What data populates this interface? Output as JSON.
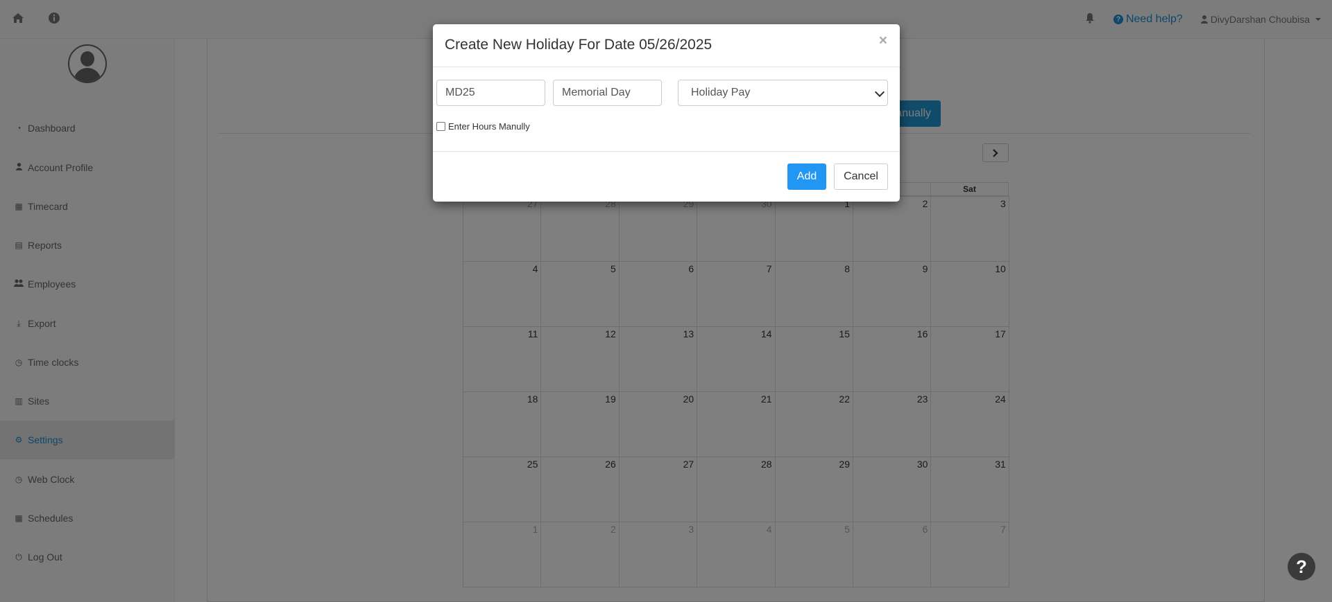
{
  "navbar": {
    "home_icon": "home-icon",
    "info_icon": "info-icon",
    "bell_icon": "bell-icon",
    "help_label": "Need help?",
    "user_name": "DivyDarshan Choubisa"
  },
  "sidebar": {
    "items": [
      {
        "label": "Dashboard",
        "icon": "dashboard-icon"
      },
      {
        "label": "Account Profile",
        "icon": "user-icon"
      },
      {
        "label": "Timecard",
        "icon": "table-icon"
      },
      {
        "label": "Reports",
        "icon": "list-icon"
      },
      {
        "label": "Employees",
        "icon": "users-icon"
      },
      {
        "label": "Export",
        "icon": "download-icon"
      },
      {
        "label": "Time clocks",
        "icon": "clock-icon"
      },
      {
        "label": "Sites",
        "icon": "building-icon"
      },
      {
        "label": "Settings",
        "icon": "gear-icon",
        "active": true
      },
      {
        "label": "Web Clock",
        "icon": "clock-icon"
      },
      {
        "label": "Schedules",
        "icon": "calendar-icon"
      },
      {
        "label": "Log Out",
        "icon": "power-icon"
      }
    ]
  },
  "main": {
    "manual_button_label": "anually",
    "next_label": ">"
  },
  "calendar": {
    "visible_headers": [
      "Sat"
    ],
    "weeks": [
      [
        {
          "d": "27",
          "o": true
        },
        {
          "d": "28",
          "o": true
        },
        {
          "d": "29",
          "o": true
        },
        {
          "d": "30",
          "o": true
        },
        {
          "d": "1"
        },
        {
          "d": "2"
        },
        {
          "d": "3"
        }
      ],
      [
        {
          "d": "4"
        },
        {
          "d": "5"
        },
        {
          "d": "6"
        },
        {
          "d": "7"
        },
        {
          "d": "8"
        },
        {
          "d": "9"
        },
        {
          "d": "10"
        }
      ],
      [
        {
          "d": "11"
        },
        {
          "d": "12"
        },
        {
          "d": "13"
        },
        {
          "d": "14"
        },
        {
          "d": "15"
        },
        {
          "d": "16"
        },
        {
          "d": "17"
        }
      ],
      [
        {
          "d": "18"
        },
        {
          "d": "19"
        },
        {
          "d": "20"
        },
        {
          "d": "21"
        },
        {
          "d": "22"
        },
        {
          "d": "23"
        },
        {
          "d": "24"
        }
      ],
      [
        {
          "d": "25"
        },
        {
          "d": "26"
        },
        {
          "d": "27"
        },
        {
          "d": "28"
        },
        {
          "d": "29"
        },
        {
          "d": "30"
        },
        {
          "d": "31"
        }
      ],
      [
        {
          "d": "1",
          "o": true
        },
        {
          "d": "2",
          "o": true
        },
        {
          "d": "3",
          "o": true
        },
        {
          "d": "4",
          "o": true
        },
        {
          "d": "5",
          "o": true
        },
        {
          "d": "6",
          "o": true
        },
        {
          "d": "7",
          "o": true
        }
      ]
    ]
  },
  "modal": {
    "title": "Create New Holiday For Date 05/26/2025",
    "close_label": "×",
    "code_value": "MD25",
    "name_value": "Memorial Day",
    "type_selected": "Holiday Pay",
    "checkbox_label": "Enter Hours Manully",
    "add_label": "Add",
    "cancel_label": "Cancel"
  },
  "fab": {
    "label": "?"
  }
}
